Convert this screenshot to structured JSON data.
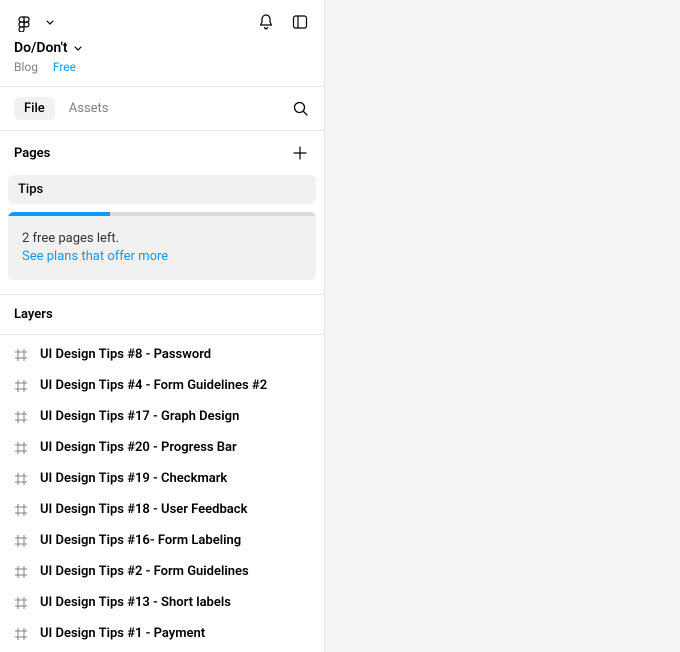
{
  "file": {
    "title": "Do/Don't",
    "breadcrumb_project": "Blog",
    "breadcrumb_plan": "Free"
  },
  "tabs": {
    "file": "File",
    "assets": "Assets"
  },
  "pages": {
    "header": "Pages",
    "items": [
      "Tips"
    ]
  },
  "quota": {
    "fill_percent": 33,
    "message": "2 free pages left.",
    "link": "See plans that offer more"
  },
  "layers": {
    "header": "Layers",
    "items": [
      "UI Design Tips #8 - Password",
      "UI Design Tips #4 - Form Guidelines #2",
      "UI Design Tips #17 - Graph Design",
      "UI Design Tips #20 - Progress Bar",
      "UI Design Tips #19 - Checkmark",
      "UI Design Tips #18 - User Feedback",
      "UI Design Tips #16- Form Labeling",
      "UI Design Tips #2 - Form Guidelines",
      "UI Design Tips #13 - Short labels",
      "UI Design Tips #1 - Payment"
    ]
  }
}
